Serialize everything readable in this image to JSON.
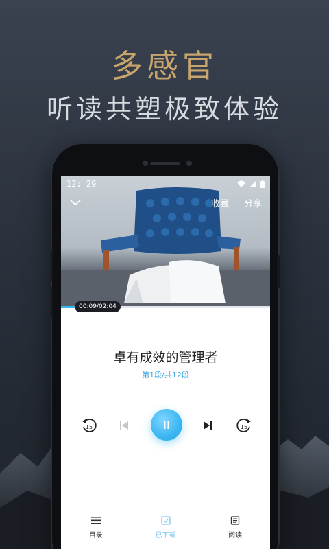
{
  "promo": {
    "headline": "多感官",
    "subline": "听读共塑极致体验"
  },
  "status_bar": {
    "time": "12: 29"
  },
  "top_bar": {
    "favorite_label": "收藏",
    "share_label": "分享"
  },
  "player": {
    "elapsed_total": "00:09/02:04",
    "progress": 0.07,
    "title": "卓有成效的管理者",
    "section": "第1段/共12段",
    "rewind_seconds": "15",
    "forward_seconds": "15"
  },
  "tabs": [
    {
      "label": "目录",
      "icon": "list-icon"
    },
    {
      "label": "已下载",
      "icon": "download-check-icon"
    },
    {
      "label": "阅读",
      "icon": "book-read-icon"
    }
  ],
  "colors": {
    "accent": "#35b6f0",
    "headline_gold": "#c9a56e",
    "tab_active": "#7fc4ec"
  }
}
